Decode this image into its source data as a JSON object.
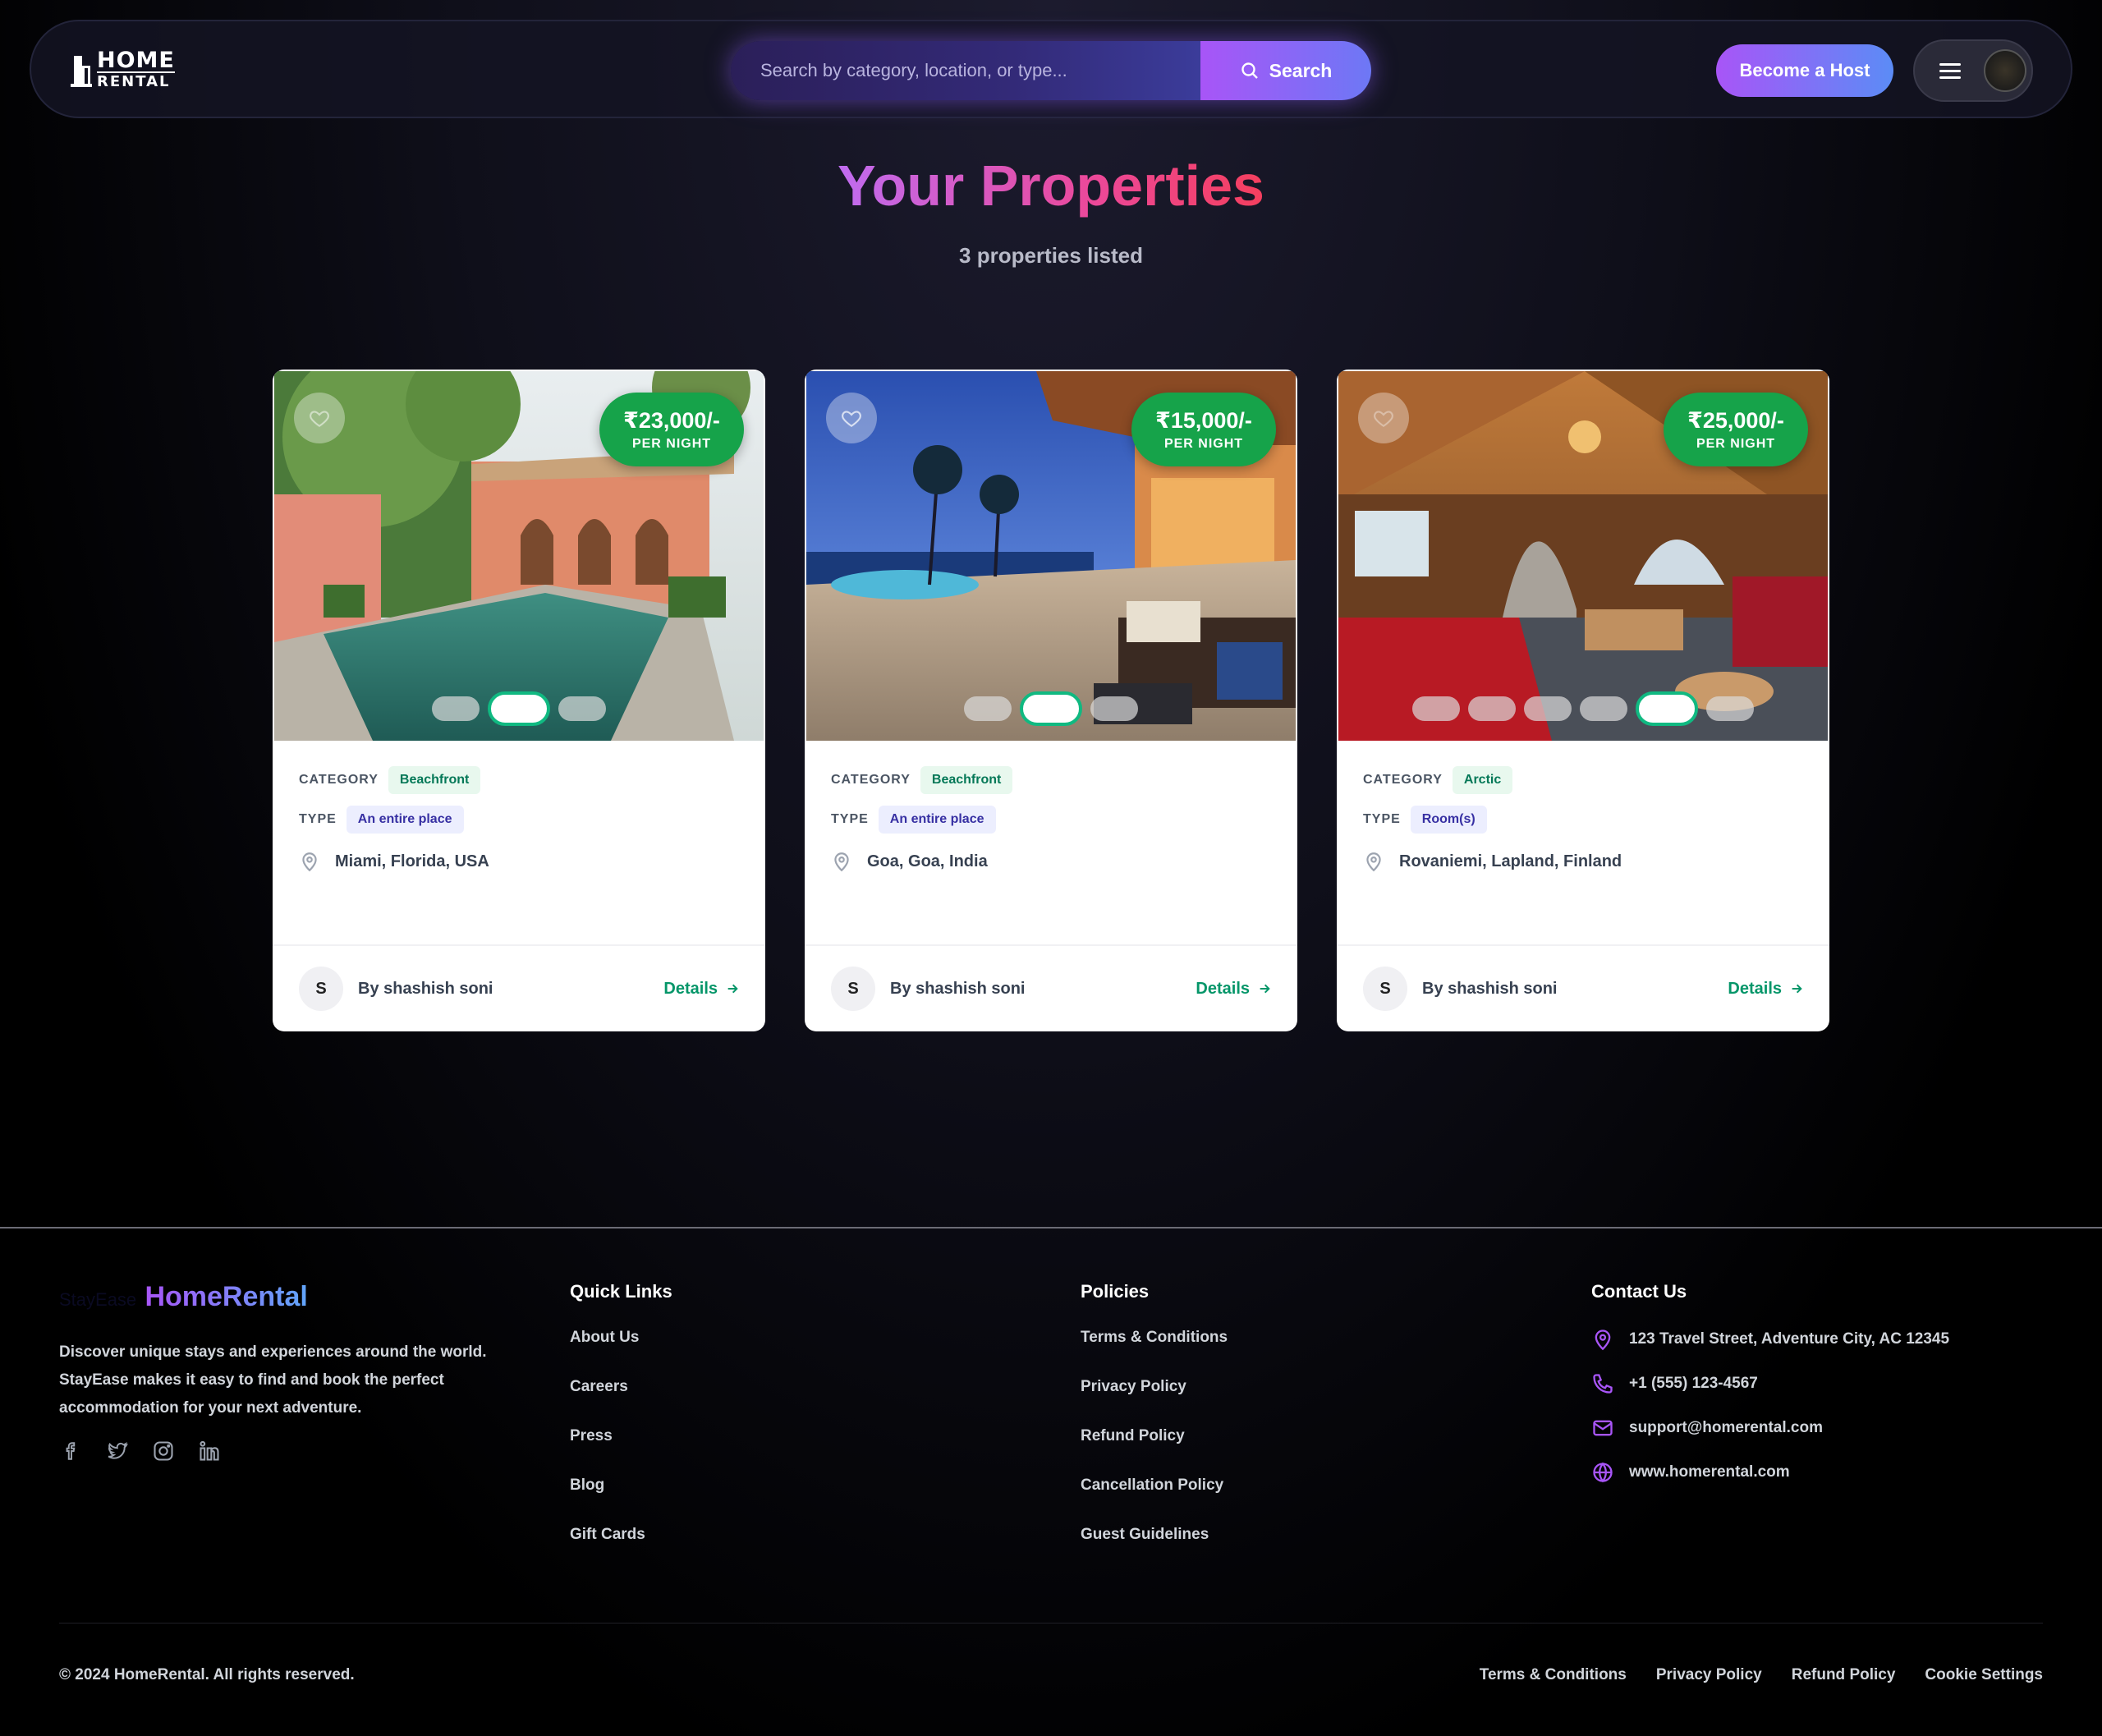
{
  "nav": {
    "logo_line1": "HOME",
    "logo_line2": "RENTAL",
    "search_placeholder": "Search by category, location, or type...",
    "search_button": "Search",
    "become_host": "Become a Host"
  },
  "header": {
    "title": "Your Properties",
    "subtitle": "3 properties listed"
  },
  "labels": {
    "category": "CATEGORY",
    "type": "TYPE",
    "per_night": "PER NIGHT",
    "details": "Details"
  },
  "properties": [
    {
      "price": "₹23,000/-",
      "category": "Beachfront",
      "type": "An entire place",
      "location": "Miami, Florida, USA",
      "host_initial": "S",
      "host": "By shashish soni",
      "image_count": 3,
      "active_image": 2
    },
    {
      "price": "₹15,000/-",
      "category": "Beachfront",
      "type": "An entire place",
      "location": "Goa, Goa, India",
      "host_initial": "S",
      "host": "By shashish soni",
      "image_count": 3,
      "active_image": 2
    },
    {
      "price": "₹25,000/-",
      "category": "Arctic",
      "type": "Room(s)",
      "location": "Rovaniemi, Lapland, Finland",
      "host_initial": "S",
      "host": "By shashish soni",
      "image_count": 6,
      "active_image": 5
    }
  ],
  "footer": {
    "brand_ghost": "StayEase",
    "brand": "HomeRental",
    "description": "Discover unique stays and experiences around the world. StayEase makes it easy to find and book the perfect accommodation for your next adventure.",
    "socials": [
      "facebook-icon",
      "twitter-icon",
      "instagram-icon",
      "linkedin-icon"
    ],
    "quick_links_title": "Quick Links",
    "quick_links": [
      "About Us",
      "Careers",
      "Press",
      "Blog",
      "Gift Cards"
    ],
    "policies_title": "Policies",
    "policies": [
      "Terms & Conditions",
      "Privacy Policy",
      "Refund Policy",
      "Cancellation Policy",
      "Guest Guidelines"
    ],
    "contact_title": "Contact Us",
    "contact": {
      "address": "123 Travel Street, Adventure City, AC 12345",
      "phone": "+1 (555) 123-4567",
      "email": "support@homerental.com",
      "website": "www.homerental.com"
    },
    "copyright": "© 2024 HomeRental. All rights reserved.",
    "bottom_links": [
      "Terms & Conditions",
      "Privacy Policy",
      "Refund Policy",
      "Cookie Settings"
    ]
  },
  "colors": {
    "accent_purple": "#a855f7",
    "accent_blue": "#60a5fa",
    "price_green": "#16a34a",
    "details_green": "#059669"
  }
}
